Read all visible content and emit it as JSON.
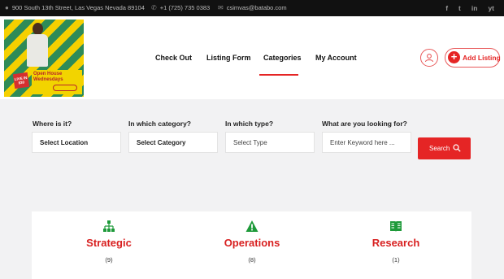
{
  "topbar": {
    "address": "900 South 13th Street, Las Vegas Nevada 89104",
    "phone": "+1 (725) 735 0383",
    "email": "csimvas@batabo.com",
    "social": [
      "f",
      "t",
      "in",
      "yt"
    ]
  },
  "logo": {
    "live_text": "LIVE IN 830",
    "banner_line1": "Open House",
    "banner_line2": "Wednesdays"
  },
  "nav": {
    "items": [
      "Check Out",
      "Listing Form",
      "Categories",
      "My Account"
    ],
    "active": "Categories"
  },
  "header_actions": {
    "add_listing_label": "Add Listing"
  },
  "search": {
    "fields": [
      {
        "label": "Where is it?",
        "value": "Select Location"
      },
      {
        "label": "In which category?",
        "value": "Select Category"
      },
      {
        "label": "In which type?",
        "value": "Select Type"
      },
      {
        "label": "What are you looking for?",
        "placeholder": "Enter Keyword here ..."
      }
    ],
    "button_label": "Search"
  },
  "categories": [
    {
      "name": "Strategic",
      "count": "(9)",
      "icon": "sitemap-icon",
      "icon_color": "#1e9a3a"
    },
    {
      "name": "Operations",
      "count": "(8)",
      "icon": "warning-icon",
      "icon_color": "#1e9a3a"
    },
    {
      "name": "Research",
      "count": "(1)",
      "icon": "book-icon",
      "icon_color": "#1e9a3a"
    }
  ],
  "colors": {
    "accent": "#e52525",
    "topbar_bg": "#111111",
    "category_icon": "#1e9a3a"
  }
}
